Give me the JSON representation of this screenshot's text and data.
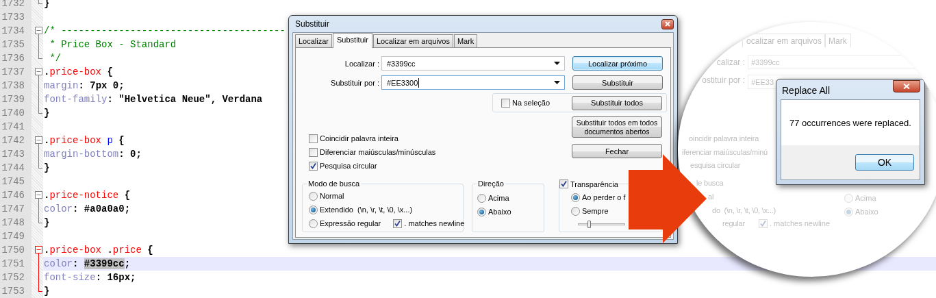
{
  "editor": {
    "lines": [
      {
        "number": "1732",
        "kind": "fold-end",
        "active": false,
        "current": false,
        "tokens": [
          {
            "text": "}",
            "kind": "punct"
          }
        ]
      },
      {
        "number": "1733",
        "kind": "plain"
      },
      {
        "number": "1734",
        "kind": "fold-start",
        "active": false,
        "current": false,
        "tokens": [
          {
            "text": "/* ---------------------------------------",
            "kind": "comment"
          }
        ]
      },
      {
        "number": "1735",
        "kind": "fold-middle",
        "active": false,
        "current": false,
        "tokens": [
          {
            "text": " * Price Box - Standard",
            "kind": "comment"
          }
        ]
      },
      {
        "number": "1736",
        "kind": "fold-end",
        "active": false,
        "current": false,
        "tokens": [
          {
            "text": " */",
            "kind": "comment"
          }
        ]
      },
      {
        "number": "1737",
        "kind": "fold-start",
        "active": false,
        "current": false,
        "tokens": [
          {
            "text": ".",
            "kind": "punct"
          },
          {
            "text": "price-box",
            "kind": "selector"
          },
          {
            "text": " {",
            "kind": "punct"
          }
        ]
      },
      {
        "number": "1738",
        "kind": "fold-middle",
        "active": false,
        "current": false,
        "tokens": [
          {
            "text": "margin",
            "kind": "property"
          },
          {
            "text": ": ",
            "kind": "punct"
          },
          {
            "text": "7px 0;",
            "kind": "value"
          }
        ]
      },
      {
        "number": "1739",
        "kind": "fold-middle",
        "active": false,
        "current": false,
        "tokens": [
          {
            "text": "font-family",
            "kind": "property"
          },
          {
            "text": ": ",
            "kind": "punct"
          },
          {
            "text": "\"Helvetica Neue\", Verdana",
            "kind": "value"
          }
        ]
      },
      {
        "number": "1740",
        "kind": "fold-end",
        "active": false,
        "current": false,
        "tokens": [
          {
            "text": "}",
            "kind": "punct"
          }
        ]
      },
      {
        "number": "1741",
        "kind": "plain"
      },
      {
        "number": "1742",
        "kind": "fold-start",
        "active": false,
        "current": false,
        "tokens": [
          {
            "text": ".",
            "kind": "punct"
          },
          {
            "text": "price-box",
            "kind": "selector"
          },
          {
            "text": " p",
            "kind": "tag"
          },
          {
            "text": " {",
            "kind": "punct"
          }
        ]
      },
      {
        "number": "1743",
        "kind": "fold-middle",
        "active": false,
        "current": false,
        "tokens": [
          {
            "text": "margin-bottom",
            "kind": "property"
          },
          {
            "text": ": ",
            "kind": "punct"
          },
          {
            "text": "0;",
            "kind": "value"
          }
        ]
      },
      {
        "number": "1744",
        "kind": "fold-end",
        "active": false,
        "current": false,
        "tokens": [
          {
            "text": "}",
            "kind": "punct"
          }
        ]
      },
      {
        "number": "1745",
        "kind": "plain"
      },
      {
        "number": "1746",
        "kind": "fold-start",
        "active": false,
        "current": false,
        "tokens": [
          {
            "text": ".",
            "kind": "punct"
          },
          {
            "text": "price-notice",
            "kind": "selector"
          },
          {
            "text": " {",
            "kind": "punct"
          }
        ]
      },
      {
        "number": "1747",
        "kind": "fold-middle",
        "active": false,
        "current": false,
        "tokens": [
          {
            "text": "color",
            "kind": "property"
          },
          {
            "text": ": ",
            "kind": "punct"
          },
          {
            "text": "#a0a0a0;",
            "kind": "value"
          }
        ]
      },
      {
        "number": "1748",
        "kind": "fold-end",
        "active": false,
        "current": false,
        "tokens": [
          {
            "text": "}",
            "kind": "punct"
          }
        ]
      },
      {
        "number": "1749",
        "kind": "plain"
      },
      {
        "number": "1750",
        "kind": "fold-start",
        "active": true,
        "current": false,
        "tokens": [
          {
            "text": ".",
            "kind": "punct"
          },
          {
            "text": "price-box",
            "kind": "selector"
          },
          {
            "text": " .",
            "kind": "punct"
          },
          {
            "text": "price",
            "kind": "selector"
          },
          {
            "text": " {",
            "kind": "punct"
          }
        ]
      },
      {
        "number": "1751",
        "kind": "fold-middle",
        "active": true,
        "current": true,
        "tokens": [
          {
            "text": "color",
            "kind": "property"
          },
          {
            "text": ": ",
            "kind": "punct"
          },
          {
            "text": "#3399cc",
            "kind": "match"
          },
          {
            "text": ";",
            "kind": "value"
          }
        ]
      },
      {
        "number": "1752",
        "kind": "fold-middle",
        "active": true,
        "current": false,
        "tokens": [
          {
            "text": "font-size",
            "kind": "property"
          },
          {
            "text": ": ",
            "kind": "punct"
          },
          {
            "text": "16px;",
            "kind": "value"
          }
        ]
      },
      {
        "number": "1753",
        "kind": "fold-end",
        "active": true,
        "current": false,
        "tokens": [
          {
            "text": "}",
            "kind": "punct"
          }
        ]
      }
    ]
  },
  "dialog": {
    "title": "Substituir",
    "tabs": [
      {
        "label": "Localizar",
        "selected": false
      },
      {
        "label": "Substituir",
        "selected": true
      },
      {
        "label": "Localizar em arquivos",
        "selected": false
      },
      {
        "label": "Mark",
        "selected": false
      }
    ],
    "fields": [
      {
        "label": "Localizar :",
        "value": "#3399cc",
        "focused": false
      },
      {
        "label": "Substituir por :",
        "value": "#EE3300",
        "focused": true
      }
    ],
    "buttons": [
      {
        "label": "Localizar próximo",
        "default": true
      },
      {
        "label": "Substituir",
        "default": false
      },
      {
        "label": "Substituir todos",
        "default": false
      },
      {
        "label": "Substituir todos em todos documentos abertos",
        "default": false
      },
      {
        "label": "Fechar",
        "default": false
      }
    ],
    "in_selection": {
      "label": "Na seleção",
      "checked": false
    },
    "options": [
      {
        "label": "Coincidir palavra inteira",
        "checked": false
      },
      {
        "label": "Diferenciar maiúsculas/minúsculas",
        "checked": false
      },
      {
        "label": "Pesquisa circular",
        "checked": true
      }
    ],
    "search_mode": {
      "title": "Modo de busca",
      "options": [
        {
          "label": "Normal",
          "selected": false
        },
        {
          "label": "Extendido  (\\n, \\r, \\t, \\0, \\x...)",
          "selected": true
        },
        {
          "label": "Expressão regular",
          "selected": false
        }
      ],
      "newline": {
        "label": ". matches newline",
        "checked": true
      }
    },
    "direction": {
      "title": "Direção",
      "options": [
        {
          "label": "Acima",
          "selected": false
        },
        {
          "label": "Abaixo",
          "selected": true
        }
      ]
    },
    "transparency": {
      "label": "Transparência",
      "checked": true,
      "options": [
        {
          "label": "Ao perder o f",
          "selected": true
        },
        {
          "label": "Sempre",
          "selected": false
        }
      ],
      "slider": {
        "level": 0.2
      }
    }
  },
  "magnifier": {
    "items": [
      {
        "kind": "tab",
        "text": "ocalizar em arquivos"
      },
      {
        "kind": "tab",
        "text": "Mark"
      },
      {
        "kind": "label",
        "text": "calizar :"
      },
      {
        "kind": "field",
        "text": "#3399cc"
      },
      {
        "kind": "label",
        "text": "ostituir por :"
      },
      {
        "kind": "field",
        "text": "#EE33"
      },
      {
        "kind": "text",
        "text": "oincidir palavra inteira"
      },
      {
        "kind": "text",
        "text": "iferenciar maiúsculas/minú"
      },
      {
        "kind": "text",
        "text": "esquisa circular"
      },
      {
        "kind": "text",
        "text": "le busca"
      },
      {
        "kind": "text",
        "text": "al"
      },
      {
        "kind": "text",
        "text": "do  (\\n, \\r, \\t, \\0, \\x...)"
      },
      {
        "kind": "text",
        "text": "regular"
      },
      {
        "kind": "checkbox",
        "text": ". matches newline",
        "checked": true
      },
      {
        "kind": "radio",
        "text": "Acima",
        "selected": false
      },
      {
        "kind": "radio",
        "text": "Abaixo",
        "selected": true
      }
    ]
  },
  "message_box": {
    "title": "Replace All",
    "message": "77 occurrences were replaced.",
    "button": "OK"
  }
}
